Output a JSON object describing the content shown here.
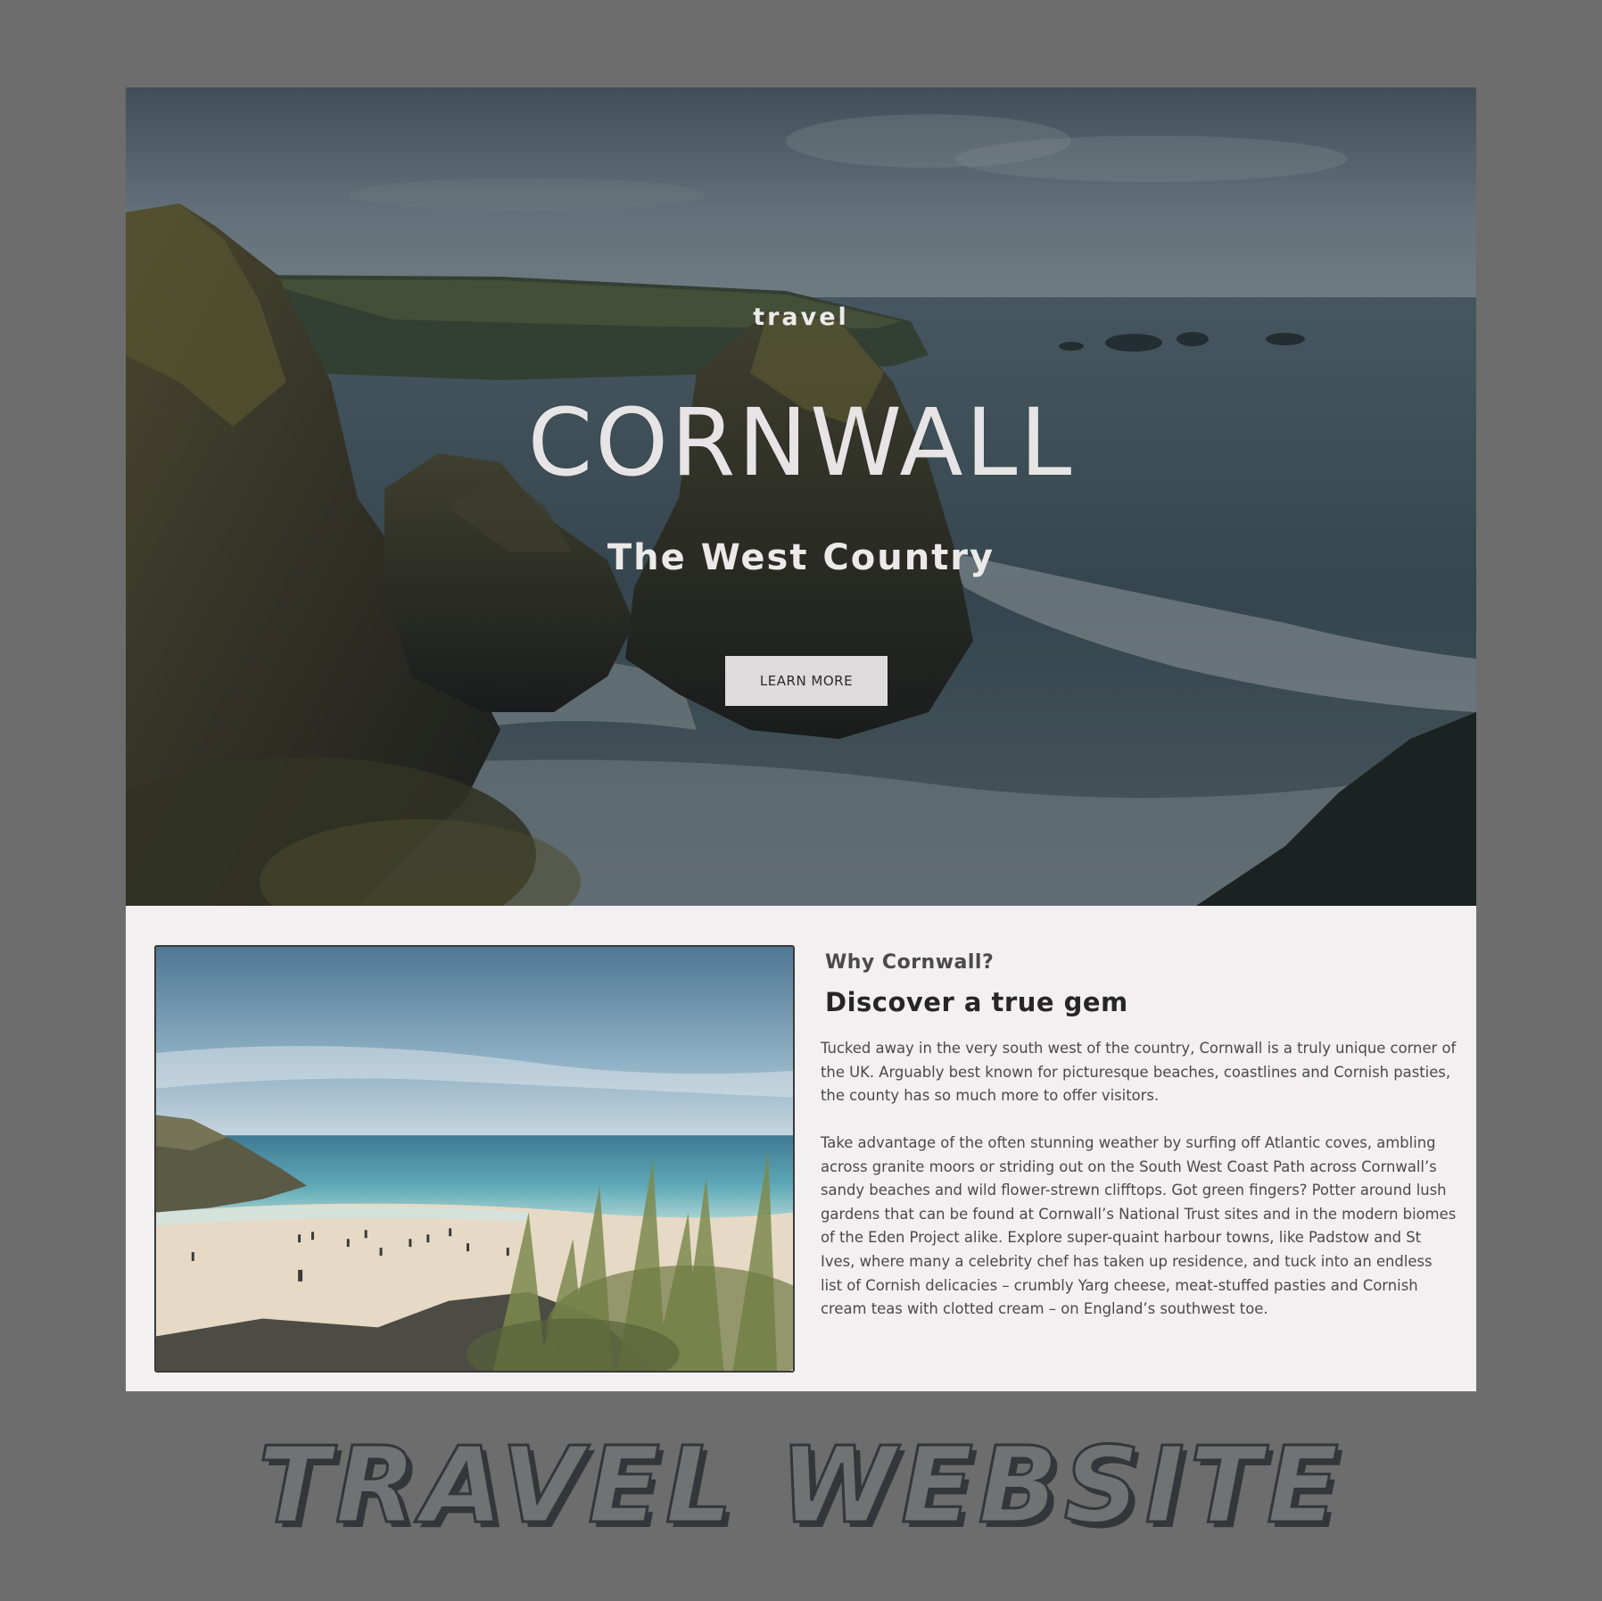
{
  "hero": {
    "kicker": "travel",
    "title": "CORNWALL",
    "subtitle": "The West Country",
    "cta_label": "LEARN MORE"
  },
  "intro": {
    "eyebrow": "Why Cornwall?",
    "heading": "Discover a true gem",
    "paragraphs": [
      "Tucked away in the very south west of the country, Cornwall is a truly unique corner of the UK. Arguably best known for picturesque beaches, coastlines and Cornish pasties, the county has so much more to offer visitors.",
      "Take advantage of the often stunning weather by surfing off Atlantic coves, ambling across granite moors or striding out on the South West Coast Path across Cornwall’s sandy beaches and wild flower-strewn clifftops. Got green fingers? Potter around lush gardens that can be found at Cornwall’s National Trust sites and in the modern biomes of the Eden Project alike. Explore super-quaint harbour towns, like Padstow and St Ives, where many a celebrity chef has taken up residence, and tuck into an endless list of Cornish delicacies – crumbly Yarg cheese, meat-stuffed pasties and Cornish cream teas with clotted cream – on England’s southwest toe."
    ]
  },
  "caption": "TRAVEL WEBSITE",
  "colors": {
    "page_bg": "#6c6d6c",
    "content_bg": "#f2f0f1",
    "button_bg": "#dedbdd",
    "caption_outline": "#35363a"
  }
}
